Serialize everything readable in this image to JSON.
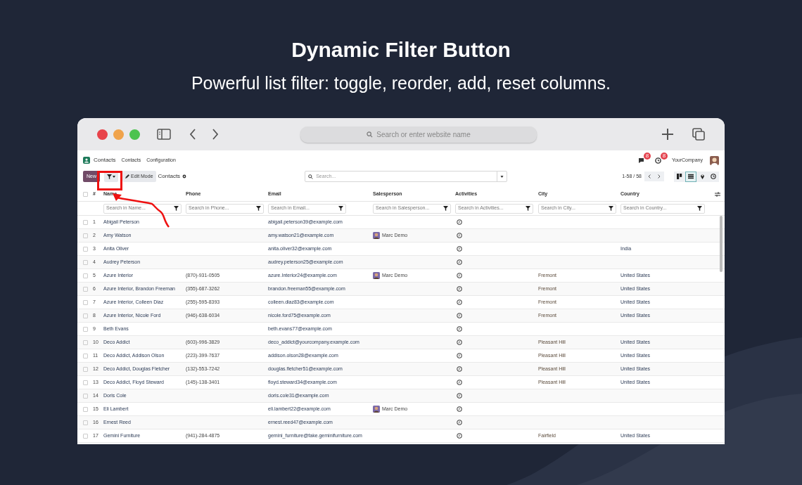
{
  "hero": {
    "title": "Dynamic Filter Button",
    "subtitle": "Powerful list filter: toggle, reorder, add, reset columns."
  },
  "browser": {
    "address_placeholder": "Search or enter website name"
  },
  "app": {
    "name": "Contacts",
    "menu": [
      "Contacts",
      "Configuration"
    ],
    "badges": [
      "8",
      "8"
    ],
    "company": "YourCompany"
  },
  "toolbar": {
    "new_label": "New",
    "edit_label": "Edit Mode",
    "breadcrumb": "Contacts",
    "search_placeholder": "Search...",
    "pager": "1-58 / 58",
    "views": [
      {
        "kind": "kanban",
        "selected": false
      },
      {
        "kind": "list",
        "selected": true
      },
      {
        "kind": "map",
        "selected": false
      },
      {
        "kind": "activity",
        "selected": false
      }
    ]
  },
  "table": {
    "number_header": "#",
    "select_all_checked": false,
    "columns": [
      {
        "label": "Name",
        "filter_placeholder": "Search in Name..."
      },
      {
        "label": "Phone",
        "filter_placeholder": "Search in Phone..."
      },
      {
        "label": "Email",
        "filter_placeholder": "Search in Email..."
      },
      {
        "label": "Salesperson",
        "filter_placeholder": "Search in Salesperson..."
      },
      {
        "label": "Activities",
        "filter_placeholder": "Search in Activities..."
      },
      {
        "label": "City",
        "filter_placeholder": "Search in City..."
      },
      {
        "label": "Country",
        "filter_placeholder": "Search in Country..."
      }
    ],
    "rows": [
      {
        "num": "1",
        "checked": false,
        "name": "Abigail Peterson",
        "email": "abigail.peterson39@example.com"
      },
      {
        "num": "2",
        "checked": false,
        "name": "Amy Watson",
        "email": "amy.watson21@example.com",
        "salesperson": "Marc Demo"
      },
      {
        "num": "3",
        "checked": false,
        "name": "Anita Oliver",
        "email": "anita.oliver32@example.com",
        "country": "India"
      },
      {
        "num": "4",
        "checked": false,
        "name": "Audrey Peterson",
        "email": "audrey.peterson25@example.com"
      },
      {
        "num": "5",
        "checked": false,
        "name": "Azure Interior",
        "phone": "(870)-931-0505",
        "email": "azure.Interior24@example.com",
        "salesperson": "Marc Demo",
        "city": "Fremont",
        "country": "United States"
      },
      {
        "num": "6",
        "checked": false,
        "name": "Azure Interior, Brandon Freeman",
        "phone": "(355)-687-3262",
        "email": "brandon.freeman55@example.com",
        "city": "Fremont",
        "country": "United States"
      },
      {
        "num": "7",
        "checked": false,
        "name": "Azure Interior, Colleen Diaz",
        "phone": "(255)-595-8393",
        "email": "colleen.diaz83@example.com",
        "city": "Fremont",
        "country": "United States"
      },
      {
        "num": "8",
        "checked": false,
        "name": "Azure Interior, Nicole Ford",
        "phone": "(946)-638-6034",
        "email": "nicole.ford75@example.com",
        "city": "Fremont",
        "country": "United States"
      },
      {
        "num": "9",
        "checked": false,
        "name": "Beth Evans",
        "email": "beth.evans77@example.com"
      },
      {
        "num": "10",
        "checked": false,
        "name": "Deco Addict",
        "phone": "(603)-996-3829",
        "email": "deco_addict@yourcompany.example.com",
        "city": "Pleasant Hill",
        "country": "United States"
      },
      {
        "num": "11",
        "checked": false,
        "name": "Deco Addict, Addison Olson",
        "phone": "(223)-399-7637",
        "email": "addison.olson28@example.com",
        "city": "Pleasant Hill",
        "country": "United States"
      },
      {
        "num": "12",
        "checked": false,
        "name": "Deco Addict, Douglas Fletcher",
        "phone": "(132)-553-7242",
        "email": "douglas.fletcher51@example.com",
        "city": "Pleasant Hill",
        "country": "United States"
      },
      {
        "num": "13",
        "checked": false,
        "name": "Deco Addict, Floyd Steward",
        "phone": "(145)-138-3401",
        "email": "floyd.steward34@example.com",
        "city": "Pleasant Hill",
        "country": "United States"
      },
      {
        "num": "14",
        "checked": false,
        "name": "Doris Cole",
        "email": "doris.cole31@example.com"
      },
      {
        "num": "15",
        "checked": false,
        "name": "Eli Lambert",
        "email": "eli.lambert22@example.com",
        "salesperson": "Marc Demo"
      },
      {
        "num": "16",
        "checked": false,
        "name": "Ernest Reed",
        "email": "ernest.reed47@example.com"
      },
      {
        "num": "17",
        "checked": false,
        "name": "Gemini Furniture",
        "phone": "(941)-284-4875",
        "email": "gemini_furniture@fake.geminifurniture.com",
        "city": "Fairfield",
        "country": "United States"
      }
    ]
  }
}
